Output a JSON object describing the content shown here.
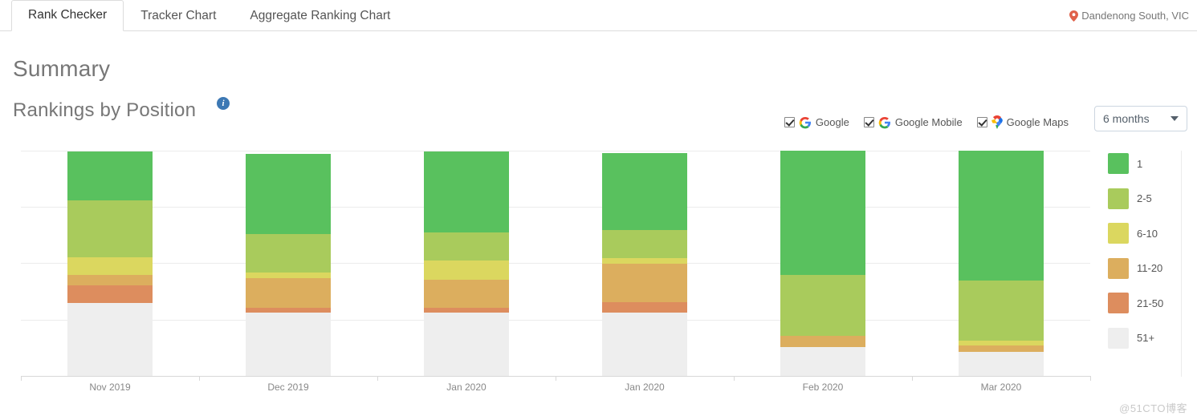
{
  "tabs": [
    {
      "label": "Rank Checker",
      "active": true
    },
    {
      "label": "Tracker Chart",
      "active": false
    },
    {
      "label": "Aggregate Ranking Chart",
      "active": false
    }
  ],
  "location": {
    "icon": "map-pin-icon",
    "text": "Dandenong South, VIC"
  },
  "headings": {
    "summary": "Summary",
    "rankings": "Rankings by Position",
    "info_icon": "info-icon"
  },
  "engines": [
    {
      "label": "Google",
      "checked": true,
      "icon": "google-g-icon"
    },
    {
      "label": "Google Mobile",
      "checked": true,
      "icon": "google-g-icon"
    },
    {
      "label": "Google Maps",
      "checked": true,
      "icon": "google-maps-pin-icon"
    }
  ],
  "range_dropdown": {
    "value": "6 months",
    "icon": "chevron-down-icon"
  },
  "watermark": "@51CTO博客",
  "chart_data": {
    "type": "bar",
    "stacked": true,
    "title": "Rankings by Position",
    "xlabel": "",
    "ylabel": "",
    "grid": true,
    "legend_position": "right",
    "ylim": [
      0,
      100
    ],
    "categories": [
      "Nov 2019",
      "Dec 2019",
      "Jan 2020",
      "Jan 2020",
      "Feb 2020",
      "Mar 2020"
    ],
    "series": [
      {
        "name": "1",
        "color": "#59c15e",
        "values": [
          21.5,
          35.5,
          35.5,
          34.0,
          55.0,
          57.5
        ]
      },
      {
        "name": "2-5",
        "color": "#a9cb5c",
        "values": [
          25.0,
          17.0,
          12.5,
          12.5,
          27.0,
          26.5
        ]
      },
      {
        "name": "6-10",
        "color": "#dbd75f",
        "values": [
          8.0,
          2.5,
          8.5,
          2.5,
          0.0,
          2.0
        ]
      },
      {
        "name": "11-20",
        "color": "#dcae5e",
        "values": [
          4.5,
          13.0,
          12.5,
          17.0,
          5.0,
          3.0
        ]
      },
      {
        "name": "21-50",
        "color": "#dd8d5e",
        "values": [
          8.0,
          2.0,
          2.0,
          4.5,
          0.0,
          0.0
        ]
      },
      {
        "name": "51+",
        "color": "#eeeeee",
        "values": [
          32.5,
          28.5,
          28.5,
          28.5,
          13.0,
          11.0
        ]
      }
    ]
  }
}
